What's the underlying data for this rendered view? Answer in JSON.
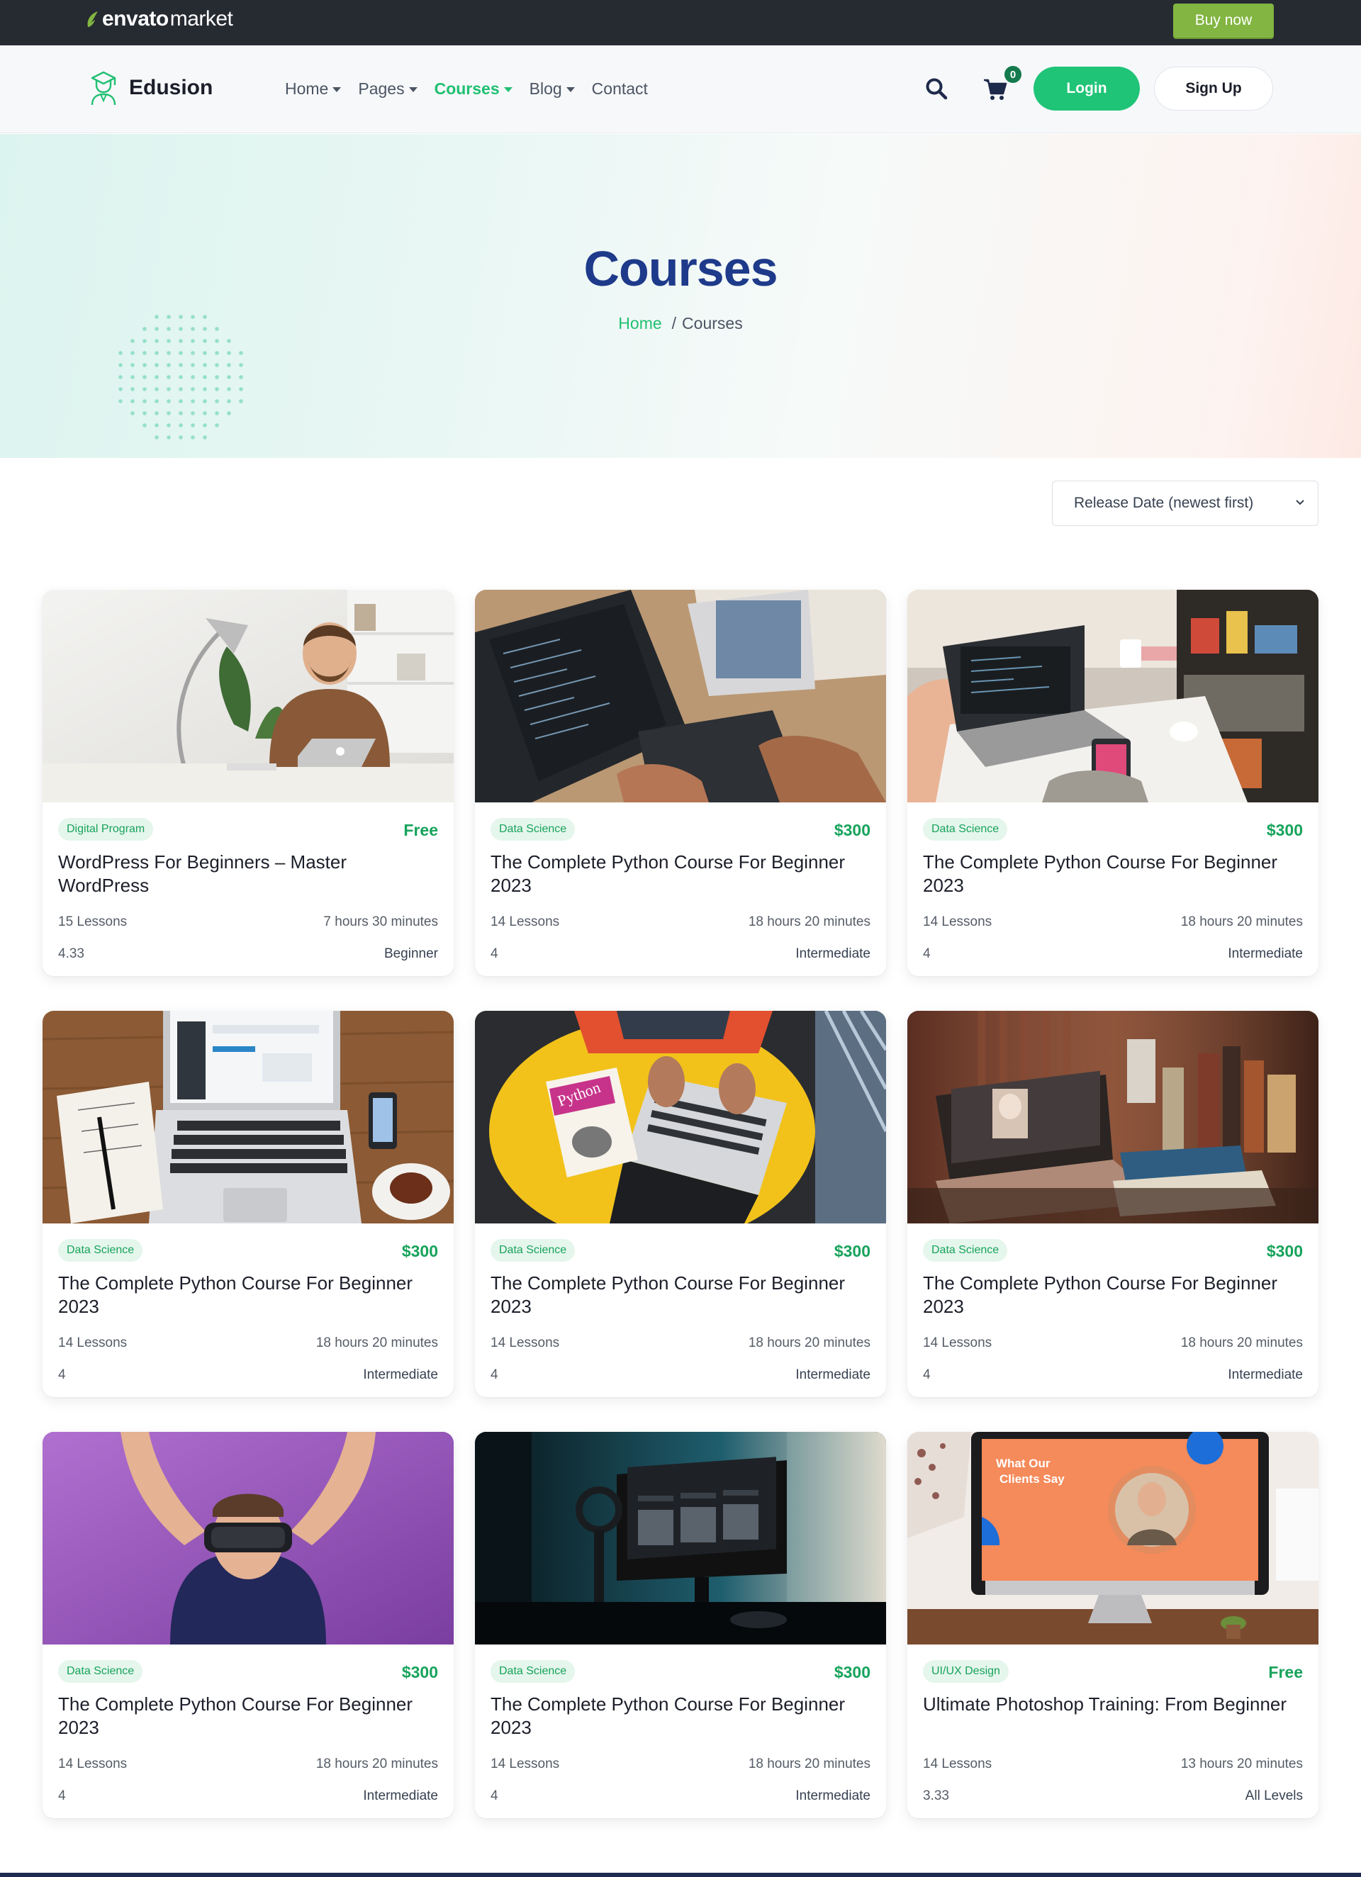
{
  "envato": {
    "logo_bold": "envato",
    "logo_regular": "market",
    "buy_label": "Buy now"
  },
  "header": {
    "brand": "Edusion",
    "nav": [
      {
        "label": "Home",
        "dropdown": true,
        "active": false
      },
      {
        "label": "Pages",
        "dropdown": true,
        "active": false
      },
      {
        "label": "Courses",
        "dropdown": true,
        "active": true
      },
      {
        "label": "Blog",
        "dropdown": true,
        "active": false
      },
      {
        "label": "Contact",
        "dropdown": false,
        "active": false
      }
    ],
    "cart_count": "0",
    "login_label": "Login",
    "signup_label": "Sign Up",
    "icons": {
      "search": "search-icon",
      "cart": "cart-icon"
    }
  },
  "hero": {
    "title": "Courses",
    "breadcrumb_home": "Home",
    "breadcrumb_sep": "/",
    "breadcrumb_current": "Courses"
  },
  "sort": {
    "selected": "Release Date (newest first)"
  },
  "colors": {
    "accent": "#20c072",
    "title_blue": "#1e3a8a",
    "topbar": "#262a31",
    "buy_green": "#82b541"
  },
  "courses": [
    {
      "image": "man-at-laptop-desk",
      "tag": "Digital Program",
      "price": "Free",
      "title": "WordPress For Beginners – Master WordPress",
      "lessons": "15 Lessons",
      "duration": "7 hours 30 minutes",
      "rating": "4.33",
      "level": "Beginner"
    },
    {
      "image": "code-laptop-typing",
      "tag": "Data Science",
      "price": "$300",
      "title": "The Complete Python Course For Beginner 2023",
      "lessons": "14 Lessons",
      "duration": "18 hours 20 minutes",
      "rating": "4",
      "level": "Intermediate"
    },
    {
      "image": "desk-workspace-laptop",
      "tag": "Data Science",
      "price": "$300",
      "title": "The Complete Python Course For Beginner 2023",
      "lessons": "14 Lessons",
      "duration": "18 hours 20 minutes",
      "rating": "4",
      "level": "Intermediate"
    },
    {
      "image": "laptop-notebook-coffee",
      "tag": "Data Science",
      "price": "$300",
      "title": "The Complete Python Course For Beginner 2023",
      "lessons": "14 Lessons",
      "duration": "18 hours 20 minutes",
      "rating": "4",
      "level": "Intermediate"
    },
    {
      "image": "laptop-yellow-chair-python-book",
      "tag": "Data Science",
      "price": "$300",
      "title": "The Complete Python Course For Beginner 2023",
      "lessons": "14 Lessons",
      "duration": "18 hours 20 minutes",
      "rating": "4",
      "level": "Intermediate"
    },
    {
      "image": "laptop-books-warm-light",
      "tag": "Data Science",
      "price": "$300",
      "title": "The Complete Python Course For Beginner 2023",
      "lessons": "14 Lessons",
      "duration": "18 hours 20 minutes",
      "rating": "4",
      "level": "Intermediate"
    },
    {
      "image": "man-vr-headset-purple",
      "tag": "Data Science",
      "price": "$300",
      "title": "The Complete Python Course For Beginner 2023",
      "lessons": "14 Lessons",
      "duration": "18 hours 20 minutes",
      "rating": "4",
      "level": "Intermediate"
    },
    {
      "image": "dark-monitor-setup",
      "tag": "Data Science",
      "price": "$300",
      "title": "The Complete Python Course For Beginner 2023",
      "lessons": "14 Lessons",
      "duration": "18 hours 20 minutes",
      "rating": "4",
      "level": "Intermediate"
    },
    {
      "image": "imac-testimonial-screen",
      "tag": "UI/UX Design",
      "price": "Free",
      "title": "Ultimate Photoshop Training: From Beginner",
      "lessons": "14 Lessons",
      "duration": "13 hours 20 minutes",
      "rating": "3.33",
      "level": "All Levels",
      "image_text": [
        "What Our",
        "Clients Say"
      ]
    }
  ]
}
